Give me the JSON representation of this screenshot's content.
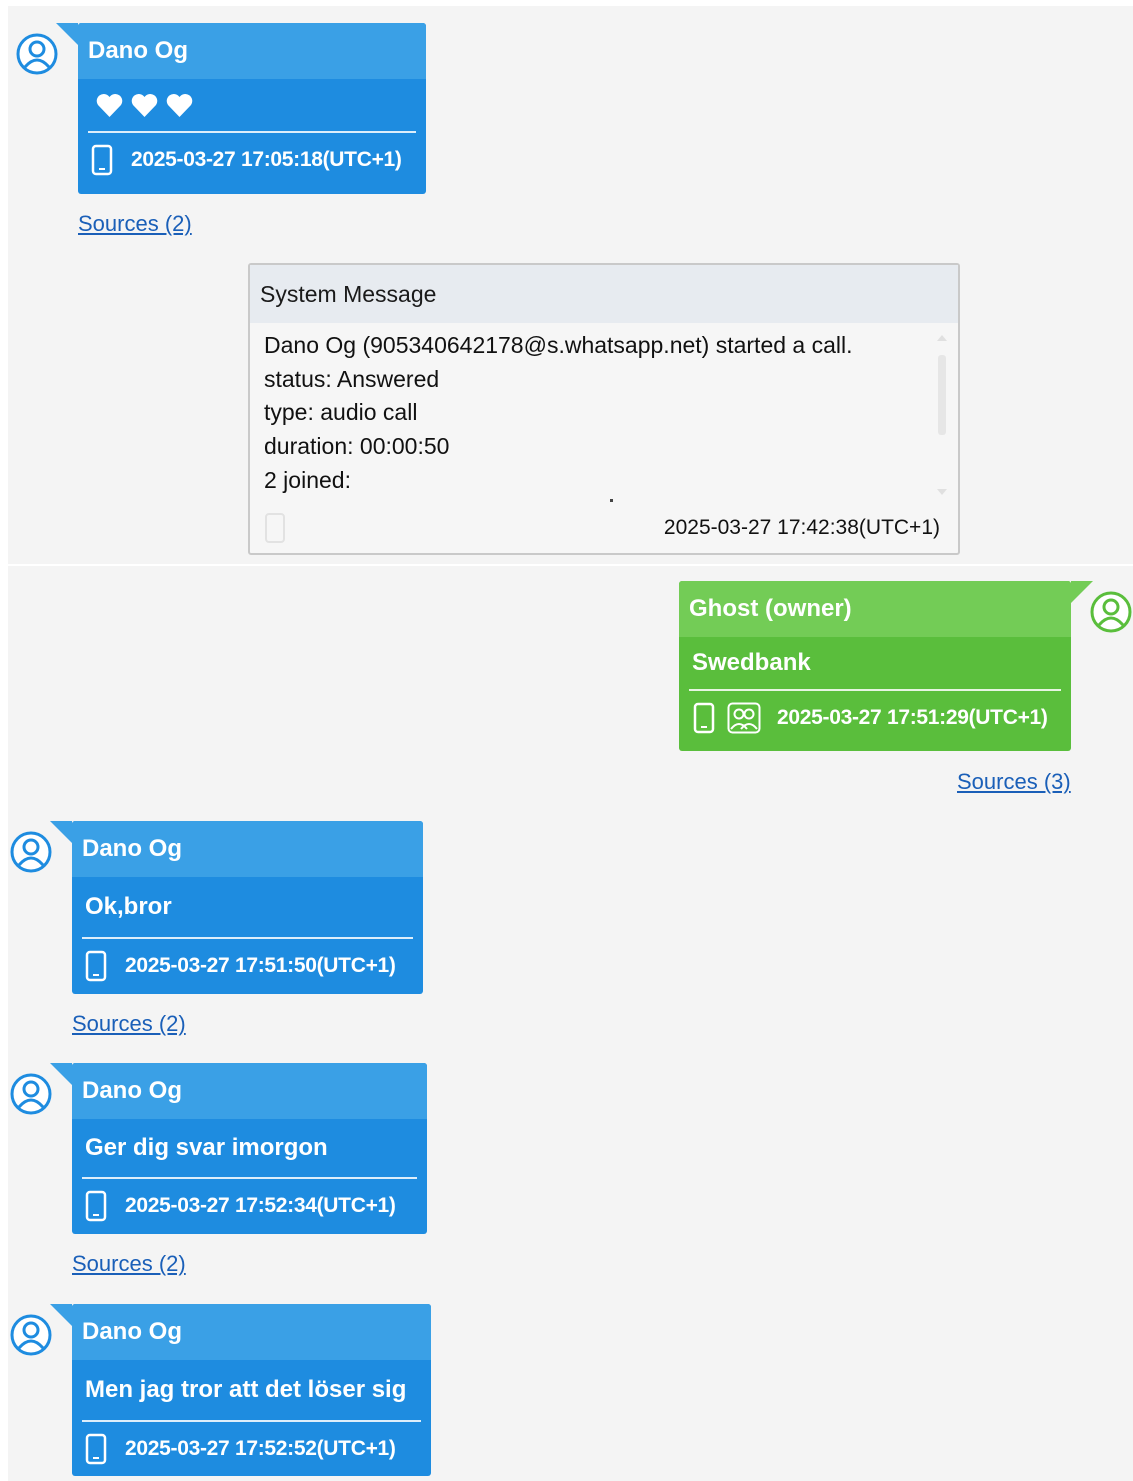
{
  "colors": {
    "incoming_bubble": "#1e8ce0",
    "incoming_header": "#3aa0e6",
    "outgoing_bubble": "#5abe3c",
    "outgoing_header": "#73cc56",
    "link": "#1a5fb8"
  },
  "messages": [
    {
      "sender": "Dano Og",
      "icons": [
        "phone-icon"
      ],
      "content": "hearts",
      "timestamp": "2025-03-27 17:05:18(UTC+1)",
      "sources": "Sources (2)"
    },
    {
      "sender": "Ghost (owner)",
      "text": "Swedbank",
      "icons": [
        "phone-icon",
        "group-icon"
      ],
      "timestamp": "2025-03-27 17:51:29(UTC+1)",
      "sources": "Sources (3)"
    },
    {
      "sender": "Dano Og",
      "text": "Ok,bror",
      "icons": [
        "phone-icon"
      ],
      "timestamp": "2025-03-27 17:51:50(UTC+1)",
      "sources": "Sources (2)"
    },
    {
      "sender": "Dano Og",
      "text": "Ger dig svar imorgon",
      "icons": [
        "phone-icon"
      ],
      "timestamp": "2025-03-27 17:52:34(UTC+1)",
      "sources": "Sources (2)"
    },
    {
      "sender": "Dano Og",
      "text": "Men jag tror att det löser sig",
      "icons": [
        "phone-icon"
      ],
      "timestamp": "2025-03-27 17:52:52(UTC+1)"
    }
  ],
  "system_message": {
    "title": "System Message",
    "lines": [
      "Dano Og (905340642178@s.whatsapp.net) started a call.",
      "status: Answered",
      "type: audio call",
      "duration: 00:00:50",
      "2 joined:"
    ],
    "timestamp": "2025-03-27 17:42:38(UTC+1)"
  }
}
